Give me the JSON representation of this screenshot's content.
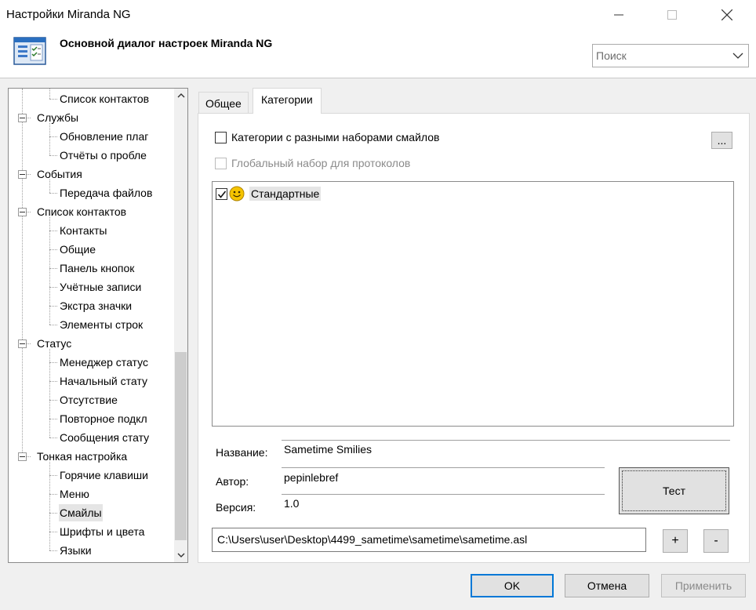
{
  "window": {
    "title": "Настройки Miranda NG",
    "header_title": "Основной диалог настроек Miranda NG"
  },
  "search": {
    "placeholder": "Поиск"
  },
  "tree": {
    "items": [
      {
        "label": "Список контактов",
        "level": 1
      },
      {
        "label": "Службы",
        "level": 0
      },
      {
        "label": "Обновление плаг",
        "level": 1
      },
      {
        "label": "Отчёты о пробле",
        "level": 1
      },
      {
        "label": "События",
        "level": 0
      },
      {
        "label": "Передача файлов",
        "level": 1
      },
      {
        "label": "Список контактов",
        "level": 0
      },
      {
        "label": "Контакты",
        "level": 1
      },
      {
        "label": "Общие",
        "level": 1
      },
      {
        "label": "Панель кнопок",
        "level": 1
      },
      {
        "label": "Учётные записи",
        "level": 1
      },
      {
        "label": "Экстра значки",
        "level": 1
      },
      {
        "label": "Элементы строк",
        "level": 1
      },
      {
        "label": "Статус",
        "level": 0
      },
      {
        "label": "Менеджер статус",
        "level": 1
      },
      {
        "label": "Начальный стату",
        "level": 1
      },
      {
        "label": "Отсутствие",
        "level": 1
      },
      {
        "label": "Повторное подкл",
        "level": 1
      },
      {
        "label": "Сообщения стату",
        "level": 1
      },
      {
        "label": "Тонкая настройка",
        "level": 0
      },
      {
        "label": "Горячие клавиши",
        "level": 1
      },
      {
        "label": "Меню",
        "level": 1
      },
      {
        "label": "Смайлы",
        "level": 1,
        "selected": true
      },
      {
        "label": "Шрифты и цвета",
        "level": 1
      },
      {
        "label": "Языки",
        "level": 1
      }
    ]
  },
  "tabs": {
    "general": "Общее",
    "categories": "Категории"
  },
  "categories": {
    "checkbox_diff_sets": "Категории с разными наборами смайлов",
    "checkbox_global": "Глобальный набор для протоколов",
    "more_button": "...",
    "list_item": "Стандартные",
    "name_label": "Название:",
    "name_value": "Sametime Smilies",
    "author_label": "Автор:",
    "author_value": "pepinlebref",
    "version_label": "Версия:",
    "version_value": "1.0",
    "test_button": "Тест",
    "path": "C:\\Users\\user\\Desktop\\4499_sametime\\sametime\\sametime.asl",
    "add_button": "+",
    "remove_button": "-"
  },
  "footer": {
    "ok": "OK",
    "cancel": "Отмена",
    "apply": "Применить"
  },
  "icons": {
    "header": "options-dialog-icon",
    "smiley": "smiley-icon",
    "accent": "#0078d7",
    "smiley_color": "#f5c400"
  }
}
